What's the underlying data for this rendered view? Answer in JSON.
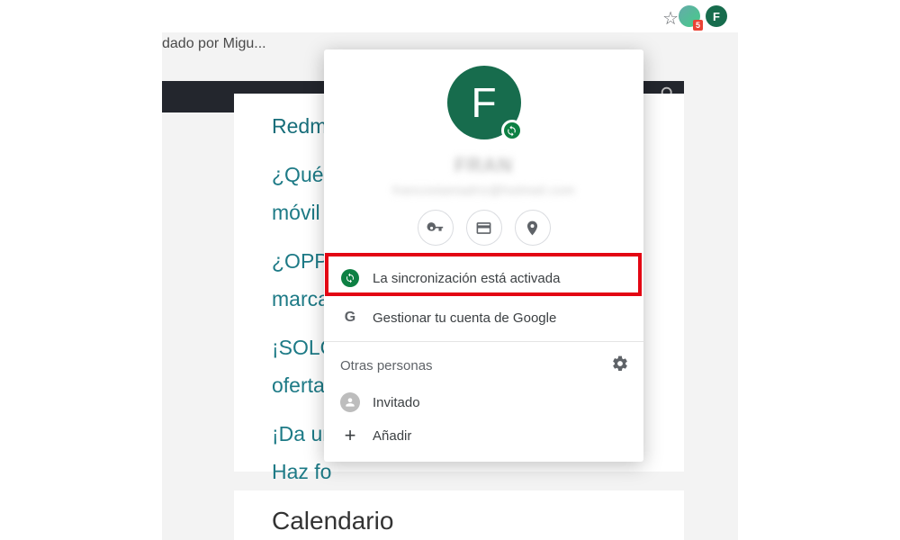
{
  "toolbar": {
    "avatar_letter": "F",
    "badge_count": "5"
  },
  "bookmark_truncated": "dado por Migu...",
  "left_fragment": "›",
  "article_links": {
    "l0": "Redm",
    "l1a": "¿Qué",
    "l1b": "móvil",
    "l2a": "¿OPPO",
    "l2b": "marca",
    "l3a": "¡SOLO",
    "l3b": "oferta",
    "l4a": "¡Da un",
    "l4b": "Haz fo"
  },
  "calendar_title": "Calendario",
  "profile": {
    "avatar_letter": "F",
    "name_obscured": "FRAN",
    "email_obscured": "francostamadriz@hotmail.com",
    "sync_label": "La sincronización está activada",
    "manage_label": "Gestionar tu cuenta de Google",
    "others_label": "Otras personas",
    "guest_label": "Invitado",
    "add_label": "Añadir"
  }
}
